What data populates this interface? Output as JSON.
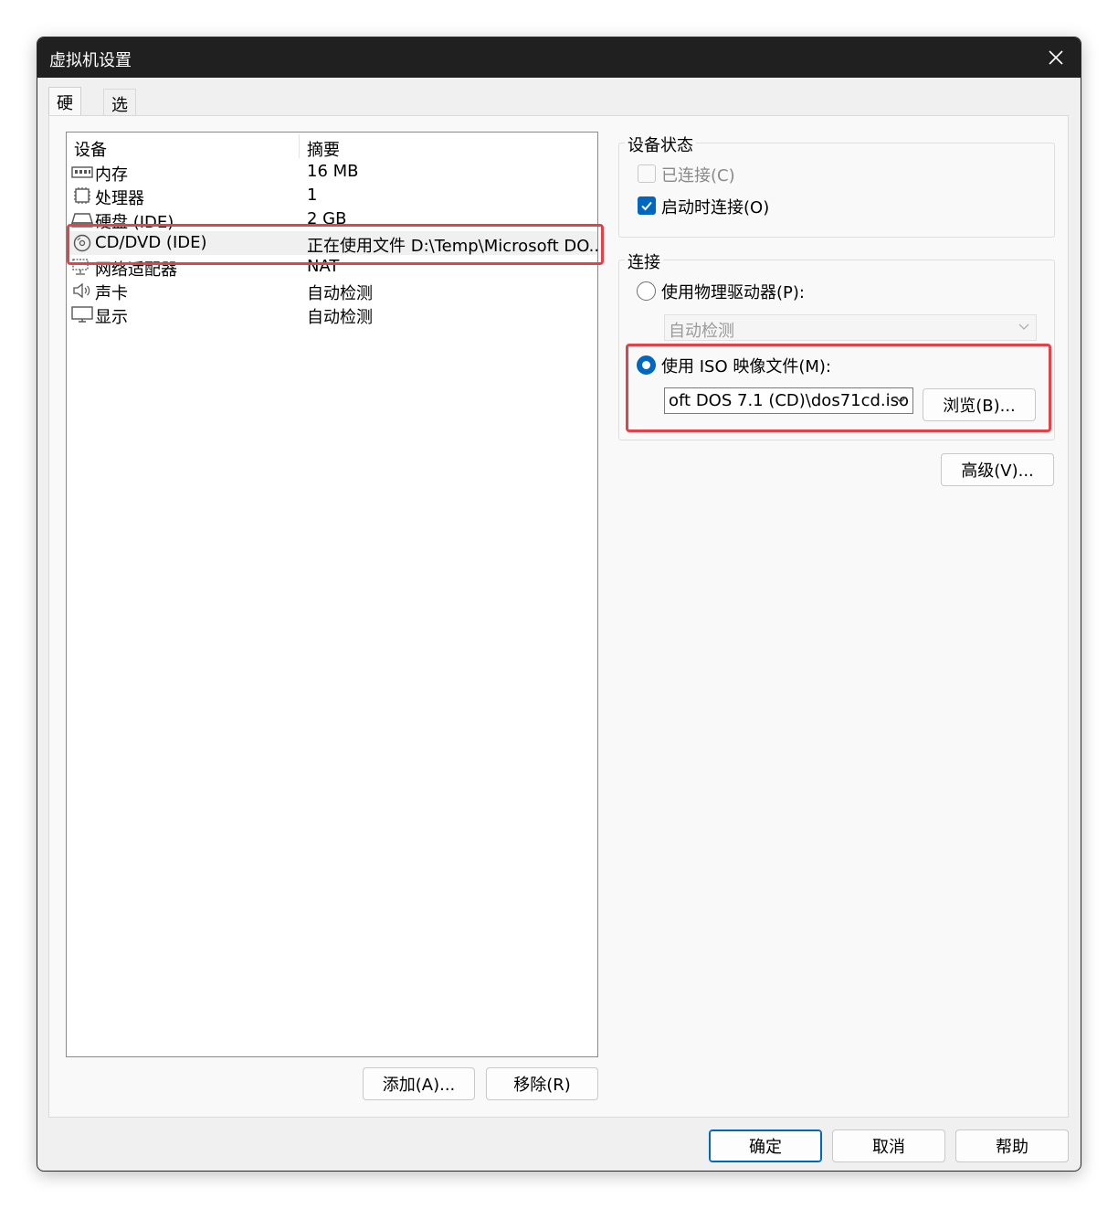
{
  "window": {
    "title": "虚拟机设置"
  },
  "tabs": [
    {
      "label": "硬件"
    },
    {
      "label": "选项"
    }
  ],
  "device_list": {
    "headers": {
      "device": "设备",
      "summary": "摘要"
    },
    "rows": [
      {
        "name": "内存",
        "summary": "16 MB",
        "icon": "memory-icon"
      },
      {
        "name": "处理器",
        "summary": "1",
        "icon": "processor-icon"
      },
      {
        "name": "硬盘 (IDE)",
        "summary": "2 GB",
        "icon": "hard-disk-icon"
      },
      {
        "name": "CD/DVD (IDE)",
        "summary": "正在使用文件 D:\\Temp\\Microsoft DO...",
        "icon": "cd-dvd-icon"
      },
      {
        "name": "网络适配器",
        "summary": "NAT",
        "icon": "network-adapter-icon"
      },
      {
        "name": "声卡",
        "summary": "自动检测",
        "icon": "speaker-icon"
      },
      {
        "name": "显示",
        "summary": "自动检测",
        "icon": "monitor-icon"
      }
    ],
    "selected_index": 3
  },
  "list_buttons": {
    "add": "添加(A)...",
    "remove": "移除(R)"
  },
  "device_status": {
    "title": "设备状态",
    "connected": {
      "label": "已连接(C)",
      "checked": false,
      "enabled": false
    },
    "connect_at_power_on": {
      "label": "启动时连接(O)",
      "checked": true,
      "enabled": true
    }
  },
  "connection": {
    "title": "连接",
    "physical_drive": {
      "label": "使用物理驱动器(P):",
      "selected": false
    },
    "physical_drive_select": {
      "value": "自动检测",
      "enabled": false
    },
    "iso_image": {
      "label": "使用 ISO 映像文件(M):",
      "selected": true
    },
    "iso_path": {
      "value": "oft DOS 7.1 (CD)\\dos71cd.iso"
    },
    "browse": "浏览(B)..."
  },
  "advanced": "高级(V)...",
  "footer": {
    "ok": "确定",
    "cancel": "取消",
    "help": "帮助"
  },
  "colors": {
    "accent": "#0067c0",
    "highlight": "#e0444b",
    "titlebar": "#202020"
  }
}
